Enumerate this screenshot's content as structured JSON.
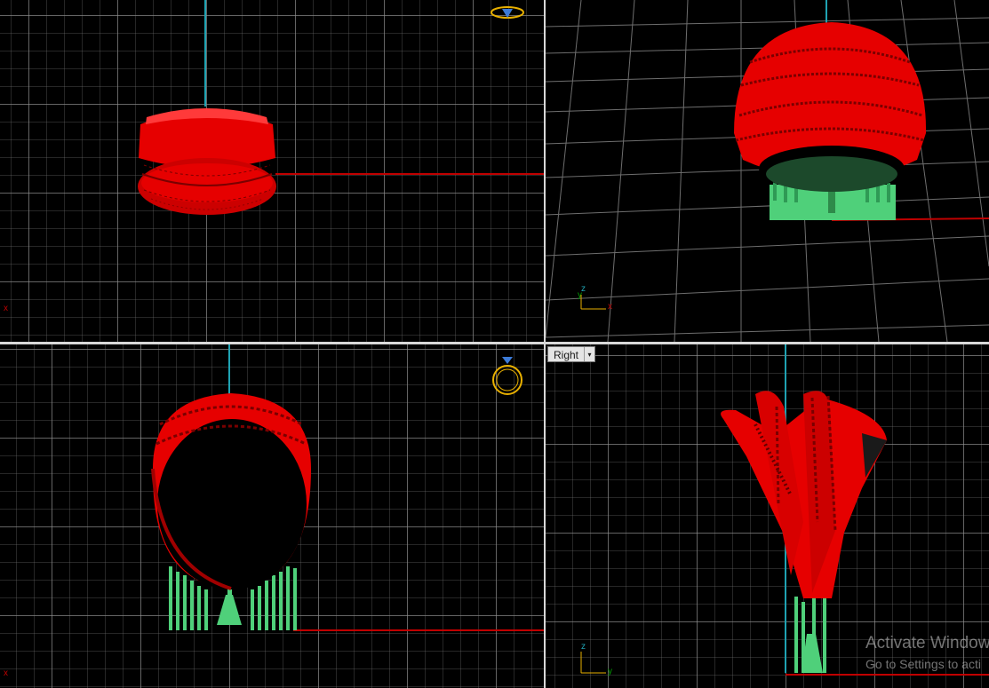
{
  "viewports": {
    "top": {
      "axis_label": "x"
    },
    "perspective": {
      "axis_labels": {
        "z": "z",
        "y": "y",
        "x": "x"
      }
    },
    "front": {
      "axis_label": "x"
    },
    "right": {
      "title": "Right",
      "dropdown_glyph": "▾",
      "axis_labels": {
        "z": "z",
        "y": "y"
      }
    }
  },
  "icons": {
    "top_gumball": "ring-top-icon",
    "front_gumball": "ring-front-icon"
  },
  "colors": {
    "model": "#e60000",
    "supports": "#4fd07a",
    "axis_x": "#c00000",
    "axis_y": "#00a000",
    "axis_z": "#1fa3b3",
    "gumball": "#e8b000"
  },
  "watermark": {
    "line1": "Activate Window",
    "line2": "Go to Settings to acti"
  }
}
